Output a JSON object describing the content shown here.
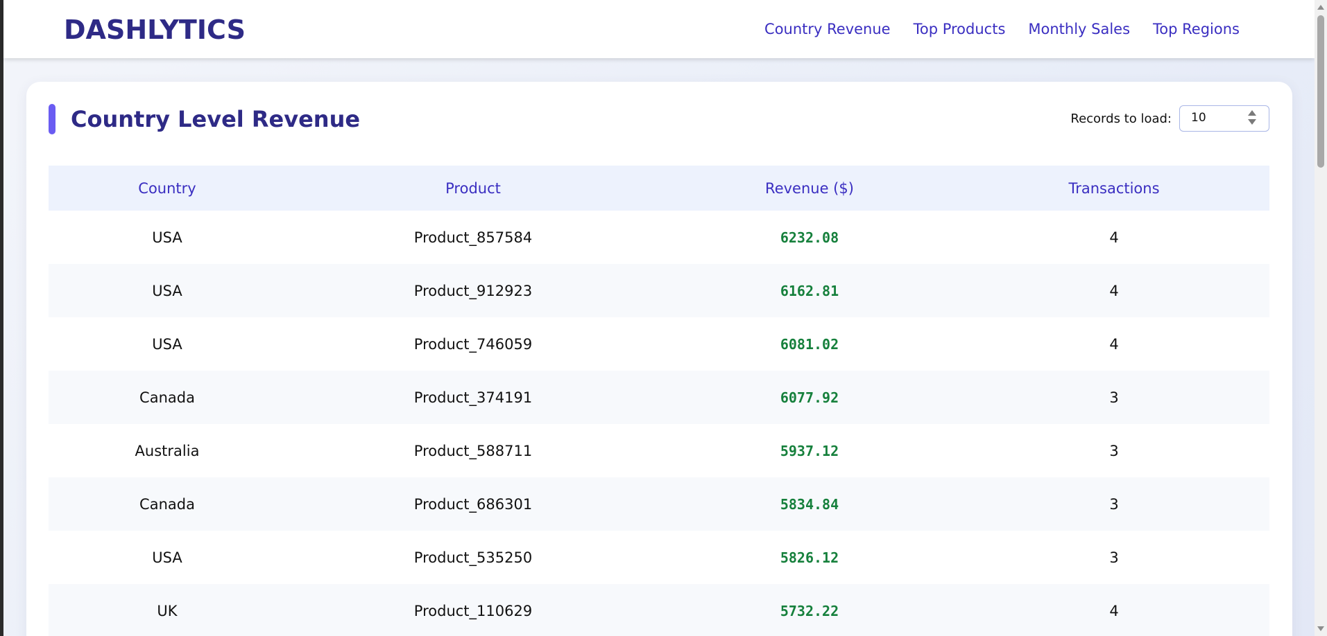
{
  "app": {
    "brand": "DASHLYTICS"
  },
  "nav": {
    "items": [
      {
        "label": "Country Revenue"
      },
      {
        "label": "Top Products"
      },
      {
        "label": "Monthly Sales"
      },
      {
        "label": "Top Regions"
      }
    ]
  },
  "section": {
    "title": "Country Level Revenue",
    "records_label": "Records to load:",
    "records_value": "10"
  },
  "table": {
    "columns": [
      "Country",
      "Product",
      "Revenue ($)",
      "Transactions"
    ],
    "rows": [
      {
        "country": "USA",
        "product": "Product_857584",
        "revenue": "6232.08",
        "transactions": "4"
      },
      {
        "country": "USA",
        "product": "Product_912923",
        "revenue": "6162.81",
        "transactions": "4"
      },
      {
        "country": "USA",
        "product": "Product_746059",
        "revenue": "6081.02",
        "transactions": "4"
      },
      {
        "country": "Canada",
        "product": "Product_374191",
        "revenue": "6077.92",
        "transactions": "3"
      },
      {
        "country": "Australia",
        "product": "Product_588711",
        "revenue": "5937.12",
        "transactions": "3"
      },
      {
        "country": "Canada",
        "product": "Product_686301",
        "revenue": "5834.84",
        "transactions": "3"
      },
      {
        "country": "USA",
        "product": "Product_535250",
        "revenue": "5826.12",
        "transactions": "3"
      },
      {
        "country": "UK",
        "product": "Product_110629",
        "revenue": "5732.22",
        "transactions": "4"
      }
    ]
  },
  "colors": {
    "brand": "#2e2a86",
    "accent": "#6a5cf2",
    "link": "#3a2ec1",
    "revenue": "#16803c"
  }
}
